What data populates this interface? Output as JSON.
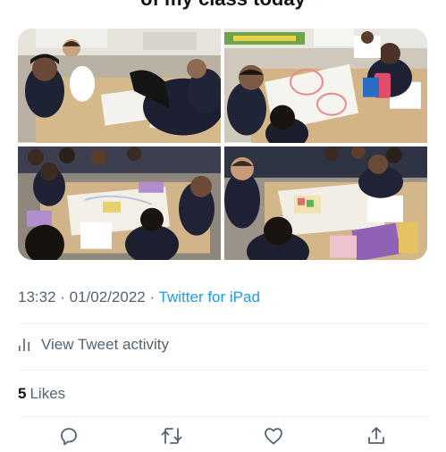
{
  "tweet": {
    "header_text": "of my class today",
    "timestamp": "13:32 · 01/02/2022",
    "separator": " · ",
    "source": "Twitter for iPad",
    "activity_label": "View Tweet activity",
    "likes_count": "5",
    "likes_label": "Likes"
  },
  "media": [
    {
      "icon": "classroom-photo"
    },
    {
      "icon": "classroom-photo"
    },
    {
      "icon": "classroom-photo"
    },
    {
      "icon": "classroom-photo"
    }
  ],
  "actions": [
    {
      "icon": "reply-icon"
    },
    {
      "icon": "retweet-icon"
    },
    {
      "icon": "like-icon"
    },
    {
      "icon": "share-icon"
    }
  ],
  "colors": {
    "text_primary": "#0f1419",
    "text_secondary": "#536471",
    "link": "#1d9bf0",
    "divider": "#eff3f4"
  }
}
